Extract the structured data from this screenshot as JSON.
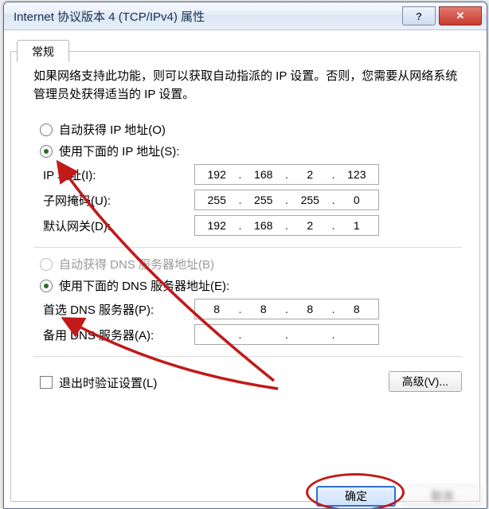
{
  "title": "Internet 协议版本 4 (TCP/IPv4) 属性",
  "tab": "常规",
  "desc": "如果网络支持此功能，则可以获取自动指派的 IP 设置。否则，您需要从网络系统管理员处获得适当的 IP 设置。",
  "radios": {
    "auto_ip": "自动获得 IP 地址(O)",
    "manual_ip": "使用下面的 IP 地址(S):",
    "auto_dns": "自动获得 DNS 服务器地址(B)",
    "manual_dns": "使用下面的 DNS 服务器地址(E):"
  },
  "labels": {
    "ip": "IP 地址(I):",
    "mask": "子网掩码(U):",
    "gateway": "默认网关(D):",
    "dns1": "首选 DNS 服务器(P):",
    "dns2": "备用 DNS 服务器(A):",
    "validate": "退出时验证设置(L)",
    "advanced": "高级(V)...",
    "ok": "确定",
    "cancel": "取消"
  },
  "values": {
    "ip": [
      "192",
      "168",
      "2",
      "123"
    ],
    "mask": [
      "255",
      "255",
      "255",
      "0"
    ],
    "gateway": [
      "192",
      "168",
      "2",
      "1"
    ],
    "dns1": [
      "8",
      "8",
      "8",
      "8"
    ],
    "dns2": [
      "",
      "",
      "",
      ""
    ]
  }
}
